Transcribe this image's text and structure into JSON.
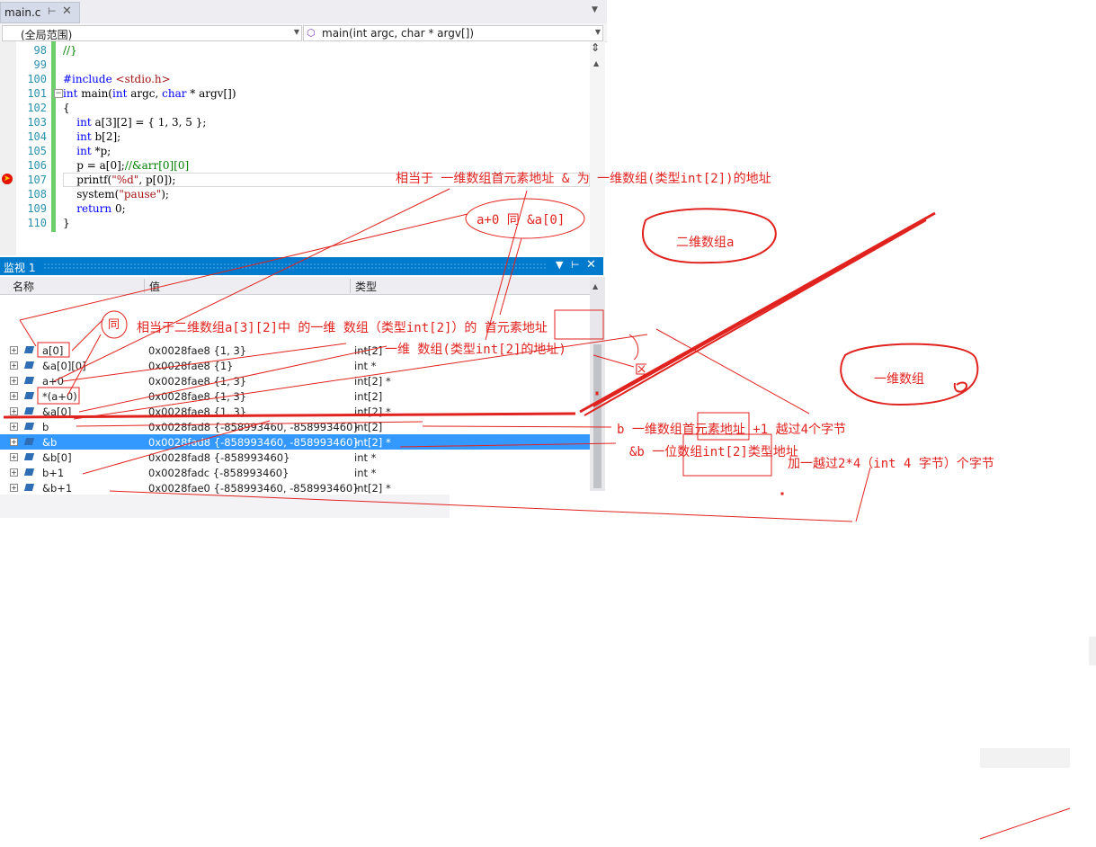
{
  "editor": {
    "tab_label": "main.c",
    "pin_icon": "pin-icon",
    "scope_combo": "(全局范围)",
    "func_combo": "main(int argc, char * argv[])",
    "line_numbers": [
      "98",
      "99",
      "100",
      "101",
      "102",
      "103",
      "104",
      "105",
      "106",
      "107",
      "108",
      "109",
      "110"
    ]
  },
  "code": {
    "l98": "//}",
    "l100_pp": "#include ",
    "l100_inc": "<stdio.h>",
    "l101_kw": "int",
    "l101_a": " main(",
    "l101_b": "int",
    "l101_c": " argc, ",
    "l101_d": "char",
    "l101_e": " * argv[])",
    "l102": "{",
    "l103_kw": "int",
    "l103_rest": " a[3][2] = { 1, 3, 5 };",
    "l104_kw": "int",
    "l104_rest": " b[2];",
    "l105_kw": "int",
    "l105_rest": " *p;",
    "l106_code": "p = a[0];",
    "l106_cm": "//&arr[0][0]",
    "l107_a": "printf(",
    "l107_str": "\"%d\"",
    "l107_b": ", p[0]);",
    "l108_a": "system(",
    "l108_str": "\"pause\"",
    "l108_b": ");",
    "l109_kw": "return",
    "l109_rest": " 0;",
    "l110": "}"
  },
  "watch": {
    "title": "监视 1",
    "col_name": "名称",
    "col_value": "值",
    "col_type": "类型",
    "rows": [
      {
        "name": "a[0]",
        "value": "0x0028fae8 {1, 3}",
        "type": "int[2]",
        "selected": false
      },
      {
        "name": "&a[0][0]",
        "value": "0x0028fae8 {1}",
        "type": "int *",
        "selected": false
      },
      {
        "name": "a+0",
        "value": "0x0028fae8 {1, 3}",
        "type": "int[2] *",
        "selected": false
      },
      {
        "name": "*(a+0)",
        "value": "0x0028fae8 {1, 3}",
        "type": "int[2]",
        "selected": false
      },
      {
        "name": "&a[0]",
        "value": "0x0028fae8 {1, 3}",
        "type": "int[2] *",
        "selected": false
      },
      {
        "name": "b",
        "value": "0x0028fad8 {-858993460, -858993460}",
        "type": "int[2]",
        "selected": false
      },
      {
        "name": "&b",
        "value": "0x0028fad8 {-858993460, -858993460}",
        "type": "int[2] *",
        "selected": true
      },
      {
        "name": "&b[0]",
        "value": "0x0028fad8 {-858993460}",
        "type": "int *",
        "selected": false
      },
      {
        "name": "b+1",
        "value": "0x0028fadc {-858993460}",
        "type": "int *",
        "selected": false
      },
      {
        "name": "&b+1",
        "value": "0x0028fae0 {-858993460, -858993460}",
        "type": "int[2] *",
        "selected": false
      }
    ]
  },
  "annotations": {
    "a1": "相当于 一维数组首元素地址 & 为 一维数组(类型int[2])的地址",
    "a2": "a+0 同 &a[0]",
    "a3": "二维数组a",
    "a4": "同",
    "a5": "相当于二维数组a[3][2]中 的一维 数组（类型int[2]）的 首元素地址",
    "a6": "一维 数组(类型int[2]的地址)",
    "a7": "区",
    "a8": "一维数组",
    "a9": "b 一维数组首元素地址   +1 越过4个字节",
    "a10": "&b 一位数组int[2]类型地址",
    "a11": "加一越过2*4（int 4 字节）个字节"
  },
  "colors": {
    "annotation_red": "#e0231f",
    "selection_blue": "#3399ff",
    "title_blue": "#007acc"
  }
}
